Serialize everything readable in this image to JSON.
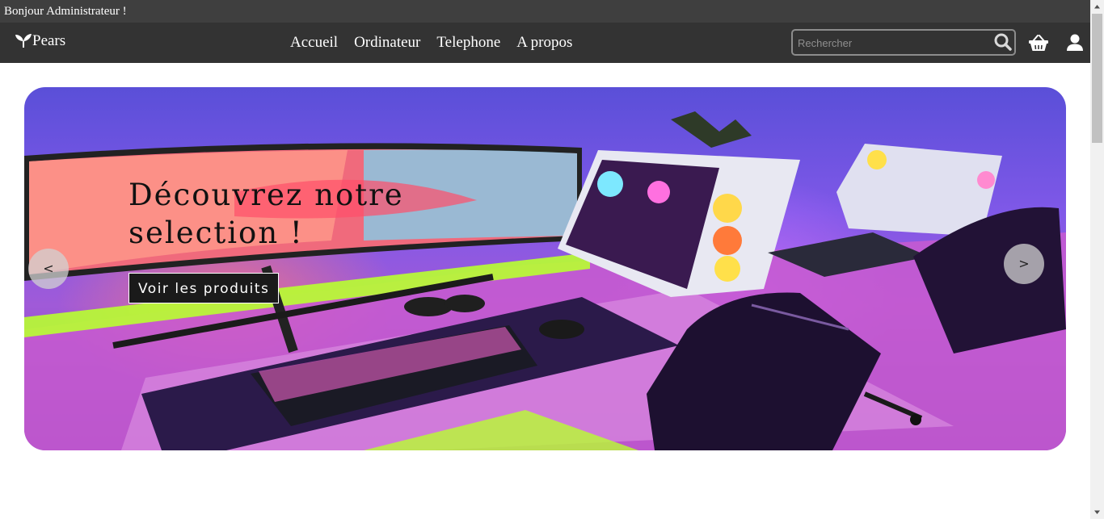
{
  "header": {
    "greeting": "Bonjour Administrateur !"
  },
  "navbar": {
    "brand": "Pears",
    "links": [
      "Accueil",
      "Ordinateur",
      "Telephone",
      "A propos"
    ],
    "search": {
      "placeholder": "Rechercher",
      "value": ""
    },
    "icons": [
      "leaf-logo-icon",
      "search-icon",
      "basket-icon",
      "user-icon"
    ]
  },
  "hero": {
    "title": "Découvrez notre selection !",
    "button_label": "Voir les produits",
    "prev_label": "<",
    "next_label": ">"
  },
  "colors": {
    "topbar": "#3f3f3f",
    "navbar": "#333333",
    "button_bg": "#1a1a1a",
    "text_light": "#ffffff"
  }
}
